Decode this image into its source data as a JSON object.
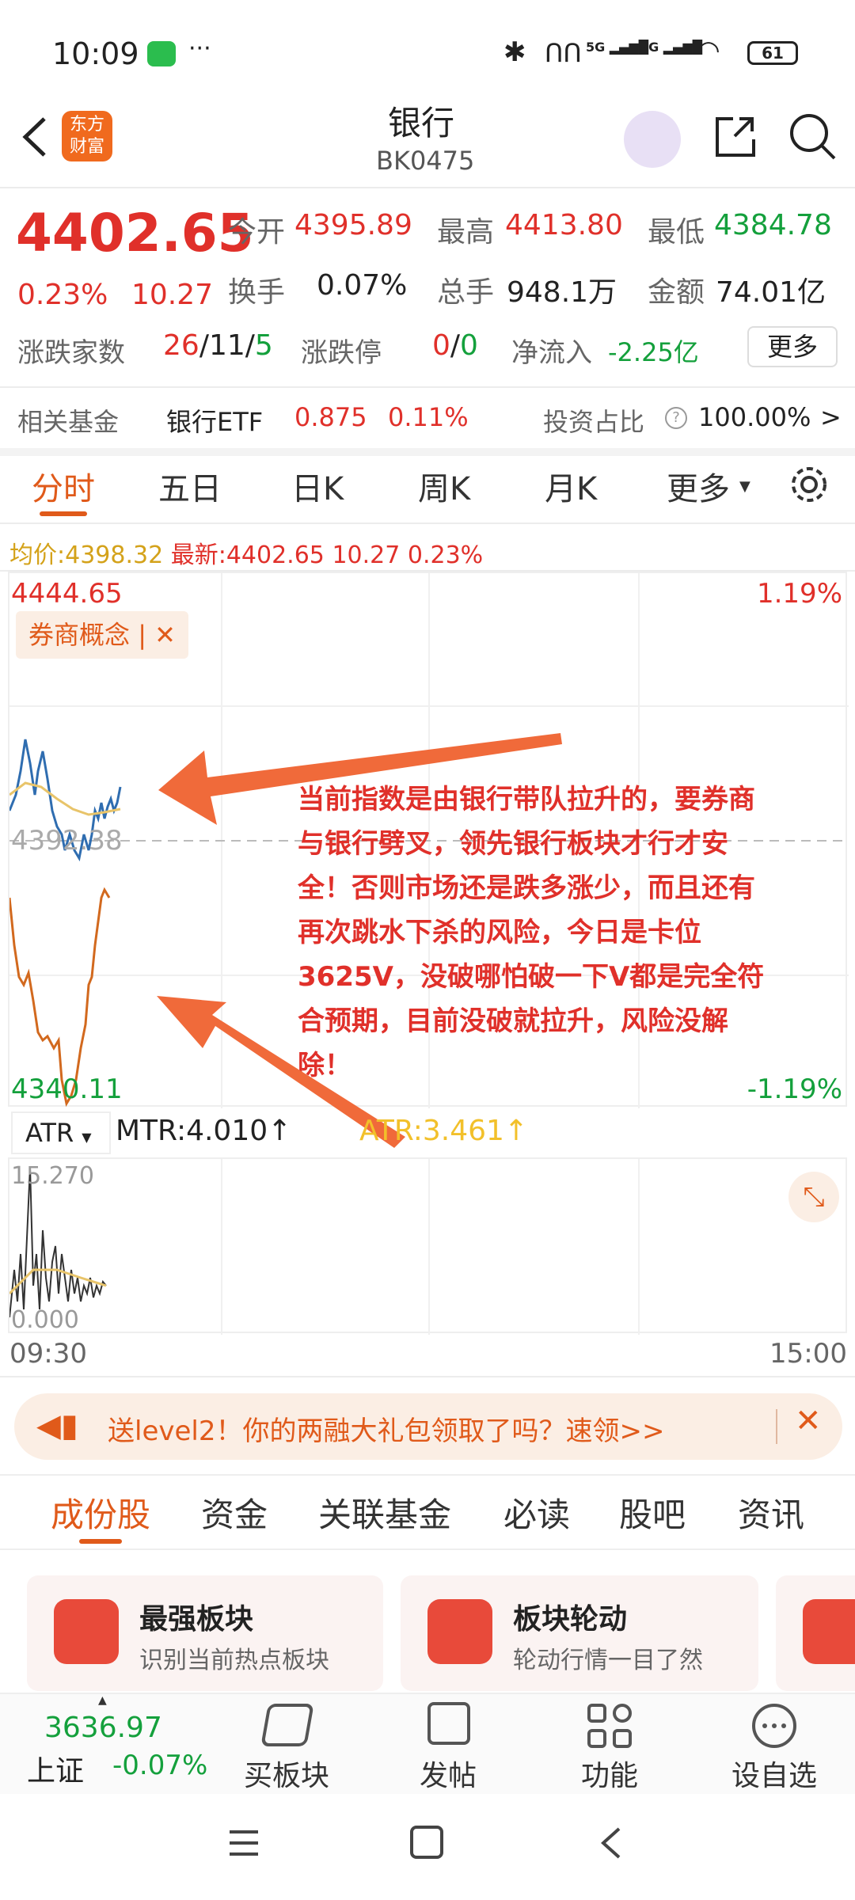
{
  "status_bar": {
    "time": "10:09",
    "battery": "61",
    "net1": "5G",
    "net2": "5G"
  },
  "header": {
    "title": "银行",
    "code": "BK0475",
    "logo_text": "东方财富"
  },
  "quote": {
    "price": "4402.65",
    "change_pct": "0.23%",
    "change": "10.27",
    "open_label": "今开",
    "open": "4395.89",
    "high_label": "最高",
    "high": "4413.80",
    "low_label": "最低",
    "low": "4384.78",
    "turnover_label": "换手",
    "turnover": "0.07%",
    "volume_label": "总手",
    "volume": "948.1万",
    "amount_label": "金额",
    "amount": "74.01亿",
    "breadth_label": "涨跌家数",
    "breadth_up": "26",
    "breadth_flat": "11",
    "breadth_down": "5",
    "breadth_sep1": "/",
    "breadth_sep2": "/",
    "limit_label": "涨跌停",
    "limit_up": "0",
    "limit_sep": "/",
    "limit_down": "0",
    "netflow_label": "净流入",
    "netflow": "-2.25亿",
    "more_button": "更多"
  },
  "fund": {
    "label": "相关基金",
    "name": "银行ETF",
    "price": "0.875",
    "pct": "0.11%",
    "ratio_label": "投资占比",
    "ratio": "100.00%",
    "chevron": ">"
  },
  "chart_tabs": [
    "分时",
    "五日",
    "日K",
    "周K",
    "月K",
    "更多"
  ],
  "info_line": {
    "avg_label": "均价:",
    "avg": "4398.32",
    "latest_label": "最新:",
    "latest": "4402.65",
    "change": "10.27",
    "pct": "0.23%"
  },
  "chart": {
    "ymax": "4444.65",
    "ymax_pct": "1.19%",
    "ymin": "4340.11",
    "ymin_pct": "-1.19%",
    "mid": "4392.38",
    "tag": "券商概念",
    "tag_sep": "|",
    "x_start": "09:30",
    "x_end": "15:00"
  },
  "annotation": "当前指数是由银行带队拉升的，要券商与银行劈叉，领先银行板块才行才安全！否则市场还是跌多涨少，而且还有再次跳水下杀的风险，今日是卡位3625V，没破哪怕破一下V都是完全符合预期，目前没破就拉升，风险没解除！",
  "indicator": {
    "name": "ATR",
    "mtr": "MTR:4.010",
    "atr": "ATR:3.461",
    "arrow": "↑",
    "ymax": "15.270",
    "ymin": "0.000"
  },
  "banner": {
    "text": "送level2！你的两融大礼包领取了吗？速领>>"
  },
  "sub_tabs": [
    "成份股",
    "资金",
    "关联基金",
    "必读",
    "股吧",
    "资讯"
  ],
  "cards": [
    {
      "title": "最强板块",
      "desc": "识别当前热点板块"
    },
    {
      "title": "板块轮动",
      "desc": "轮动行情一目了然"
    }
  ],
  "bottom_nav": {
    "index_value": "3636.97",
    "index_name": "上证",
    "index_pct": "-0.07%",
    "items": [
      "买板块",
      "发帖",
      "功能",
      "设自选"
    ]
  },
  "colors": {
    "up": "#e0302a",
    "down": "#14a03c",
    "accent": "#e05a1a",
    "price_line": "#2f6db0",
    "avg_line": "#e8c46a",
    "indicator_line": "#d2691e"
  }
}
